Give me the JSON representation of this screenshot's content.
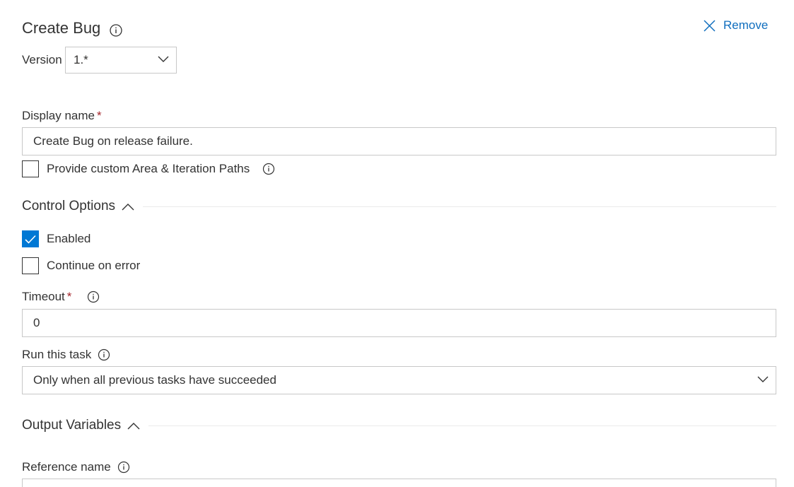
{
  "header": {
    "title": "Create Bug",
    "remove_label": "Remove"
  },
  "version": {
    "label": "Version",
    "value": "1.*"
  },
  "display_name": {
    "label": "Display name",
    "required_mark": "*",
    "value": "Create Bug on release failure."
  },
  "custom_paths": {
    "label": "Provide custom Area & Iteration Paths",
    "checked": false
  },
  "control_options": {
    "title": "Control Options",
    "enabled_label": "Enabled",
    "enabled_checked": true,
    "continue_on_error_label": "Continue on error",
    "continue_on_error_checked": false,
    "timeout_label": "Timeout",
    "timeout_required_mark": "*",
    "timeout_value": "0",
    "run_task_label": "Run this task",
    "run_task_value": "Only when all previous tasks have succeeded"
  },
  "output_variables": {
    "title": "Output Variables",
    "reference_name_label": "Reference name"
  },
  "colors": {
    "accent": "#0078d4",
    "link": "#106ebe",
    "required": "#a4262c",
    "border": "#c8c8c8"
  },
  "icons": [
    "info-icon",
    "close-icon",
    "chevron-down-icon",
    "chevron-up-icon",
    "checkmark-icon"
  ]
}
